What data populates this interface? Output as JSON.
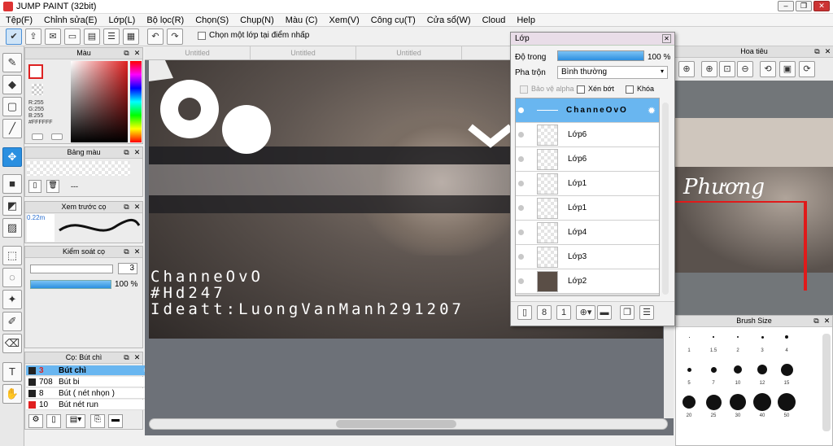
{
  "window": {
    "title": "JUMP PAINT (32bit)"
  },
  "menu": [
    "Tệp(F)",
    "Chỉnh sửa(E)",
    "Lớp(L)",
    "Bộ lọc(R)",
    "Chọn(S)",
    "Chụp(N)",
    "Màu (C)",
    "Xem(V)",
    "Công cụ(T)",
    "Cửa sổ(W)",
    "Cloud",
    "Help"
  ],
  "toolbar": {
    "select_layer_label": "Chọn một lớp tại điểm nhấp"
  },
  "doc_tabs": [
    "Untitled",
    "Untitled",
    "Untitled",
    "Un"
  ],
  "color_panel": {
    "title": "Màu",
    "r": "R:255",
    "g": "G:255",
    "b": "B:255",
    "hex": "#FFFFFF"
  },
  "swatch_panel": {
    "title": "Bảng màu",
    "value": "---"
  },
  "brush_preview": {
    "title": "Xem trước cọ",
    "size": "0.22m"
  },
  "brush_control": {
    "title": "Kiểm soát cọ",
    "size": "3",
    "opacity": "100 %"
  },
  "brush_list": {
    "title": "Cọ: Bút chì",
    "items": [
      {
        "num": "3",
        "label": "Bút chì",
        "color": "#222222",
        "selected": true
      },
      {
        "num": "708",
        "label": "Bút bi",
        "color": "#222222"
      },
      {
        "num": "8",
        "label": "Bút ( nét nhọn )",
        "color": "#222222"
      },
      {
        "num": "10",
        "label": "Bút nét run",
        "color": "#e02020"
      }
    ]
  },
  "canvas_text": {
    "line1": "ChanneOvO",
    "line2": "#Hd247",
    "line3": "Ideatt:LuongVanManh291207"
  },
  "layers_panel": {
    "title": "Lớp",
    "opacity_label": "Độ trong",
    "opacity_value": "100 %",
    "opacity_fraction": 1.0,
    "blend_label": "Pha trộn",
    "blend_value": "Bình thường",
    "protect_alpha": "Bảo vệ alpha",
    "clipping": "Xén bớt",
    "lock": "Khóa",
    "layers": [
      {
        "name": "ChanneOvO",
        "active": true
      },
      {
        "name": "Lớp6"
      },
      {
        "name": "Lớp6"
      },
      {
        "name": "Lớp1"
      },
      {
        "name": "Lớp1"
      },
      {
        "name": "Lớp4"
      },
      {
        "name": "Lớp3"
      },
      {
        "name": "Lớp2"
      }
    ]
  },
  "navigator": {
    "title": "Hoa tiêu",
    "preview_text": "Phương"
  },
  "brush_size": {
    "title": "Brush Size",
    "sizes": [
      "1",
      "1.5",
      "2",
      "3",
      "4",
      "5",
      "7",
      "10",
      "12",
      "15",
      "20",
      "25",
      "30",
      "40",
      "50"
    ]
  }
}
